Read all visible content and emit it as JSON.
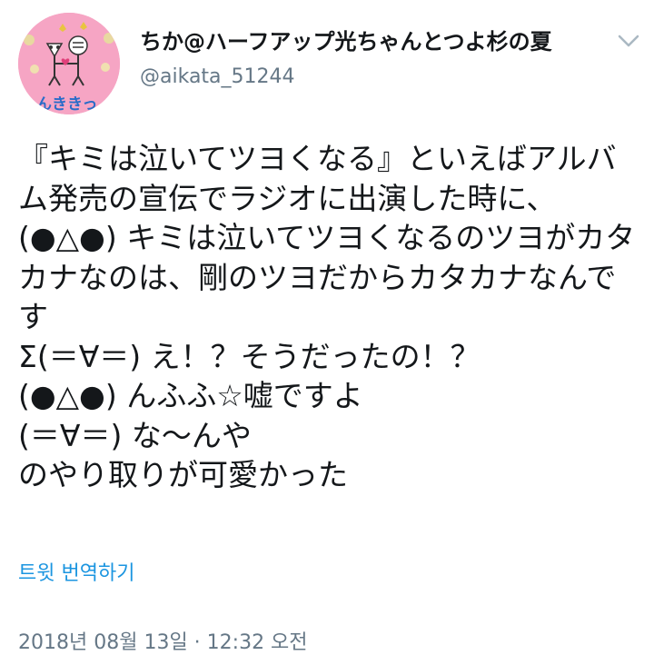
{
  "header": {
    "display_name": "ちか@ハーフアップ光ちゃんとつよ杉の夏",
    "handle": "@aikata_51244",
    "avatar": {
      "caption": "んききっ",
      "background": "#f6a5c4"
    },
    "menu_icon": "chevron-down-icon"
  },
  "tweet": {
    "text": "『キミは泣いてツヨくなる』といえばアルバム発売の宣伝でラジオに出演した時に、\n(●△●) キミは泣いてツヨくなるのツヨがカタカナなのは、剛のツヨだからカタカナなんです\nΣ(＝∀＝) え！？そうだったの！？\n(●△●) んふふ☆嘘ですよ\n(＝∀＝) な〜んや\nのやり取りが可愛かった",
    "translate_label": "트윗 번역하기",
    "timestamp": "2018년 08월 13일 · 12:32 오전"
  },
  "colors": {
    "text": "#14171a",
    "secondary": "#657786",
    "link": "#1b95e0"
  }
}
